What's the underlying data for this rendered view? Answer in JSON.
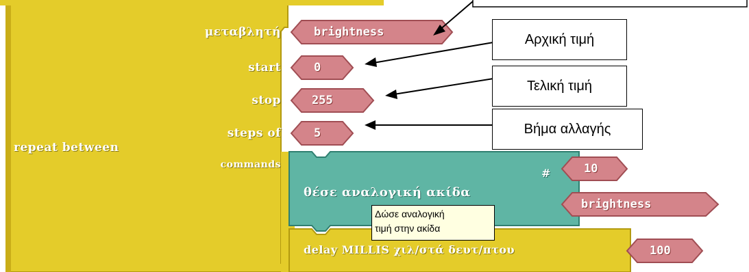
{
  "repeat_block": {
    "label": "repeat between",
    "variable_label": "μεταβλητή",
    "start_label": "start",
    "stop_label": "stop",
    "steps_label": "steps of",
    "commands_label": "commands"
  },
  "values": {
    "variable": "brightness",
    "start": "0",
    "stop": "255",
    "steps": "5"
  },
  "analog_block": {
    "label": "θέσε αναλογική ακίδα",
    "hash": "#",
    "pin_value": "10",
    "value_variable": "brightness"
  },
  "delay_block": {
    "label": "delay MILLIS  χιλ/στά δευτ/πτου",
    "value": "100"
  },
  "callouts": {
    "start": "Αρχική τιμή",
    "stop": "Τελική τιμή",
    "steps": "Βήμα αλλαγής"
  },
  "tooltip": {
    "line1": "Δώσε αναλογική",
    "line2": "τιμή στην ακίδα"
  },
  "colors": {
    "control": "#e4cc2a",
    "value": "#d4848a",
    "io": "#5fb5a4"
  }
}
